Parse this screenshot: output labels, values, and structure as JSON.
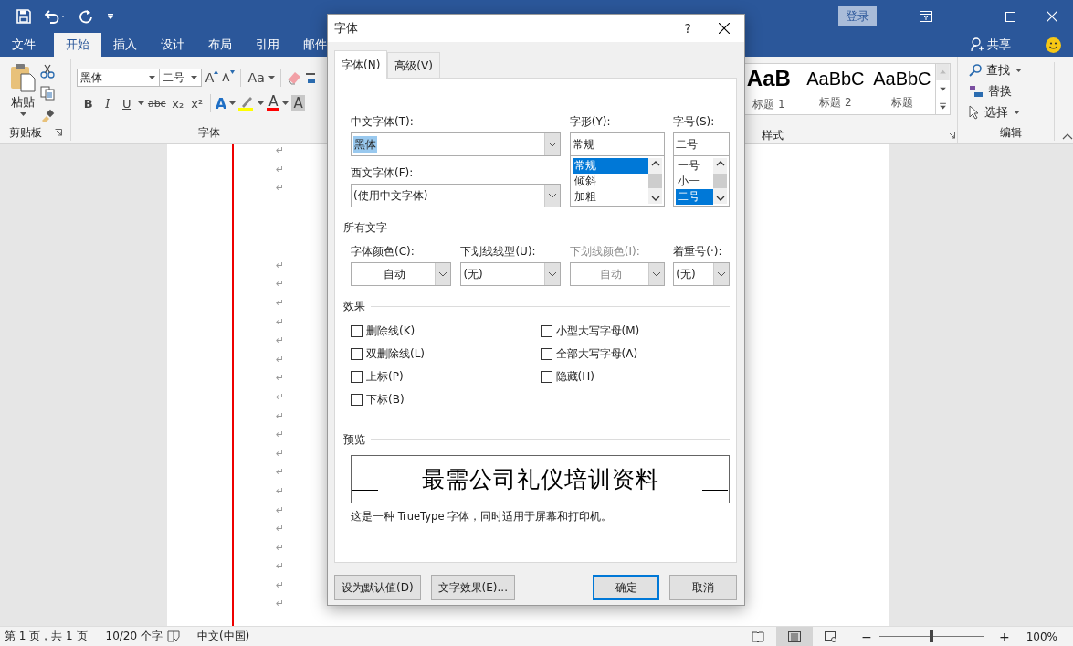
{
  "title_bar": {
    "sign_in": "登录"
  },
  "ribbon_tabs": [
    {
      "label": "文件",
      "selected": false
    },
    {
      "label": "开始",
      "selected": true
    },
    {
      "label": "插入",
      "selected": false
    },
    {
      "label": "设计",
      "selected": false
    },
    {
      "label": "布局",
      "selected": false
    },
    {
      "label": "引用",
      "selected": false
    },
    {
      "label": "邮件",
      "selected": false
    }
  ],
  "share": "共享",
  "ribbon": {
    "clipboard": {
      "paste": "粘贴",
      "label": "剪贴板"
    },
    "font": {
      "font_name": "黑体",
      "font_size": "二号",
      "grow": "A",
      "shrink": "A",
      "change_case": "Aa",
      "label": "字体",
      "format_buttons": [
        {
          "kind": "bold",
          "label": "B"
        },
        {
          "kind": "italic",
          "label": "I"
        },
        {
          "kind": "underline",
          "label": "U"
        },
        {
          "kind": "strike",
          "label": "abc"
        },
        {
          "kind": "subscript",
          "label": "x₂"
        },
        {
          "kind": "superscript",
          "label": "x²"
        }
      ],
      "color_buttons": [
        {
          "kind": "effect",
          "label": "A"
        },
        {
          "kind": "highlight",
          "color": "#ffff00"
        },
        {
          "kind": "font-color",
          "label": "A",
          "color": "#ff0000"
        },
        {
          "kind": "shading",
          "label": "A"
        }
      ]
    },
    "styles": {
      "label": "样式",
      "items": [
        {
          "preview": "AaB",
          "label": "标题 1",
          "bold": true
        },
        {
          "preview": "AaBbC",
          "label": "标题 2",
          "bold": false
        },
        {
          "preview": "AaBbC",
          "label": "标题",
          "bold": false
        }
      ]
    },
    "editing": {
      "find": "查找",
      "replace": "替换",
      "select": "选择",
      "label": "编辑"
    }
  },
  "document": {
    "marks_top": [
      "↵",
      "↵",
      "↵"
    ],
    "marks_bottom": [
      "↵",
      "↵",
      "↵",
      "↵",
      "↵",
      "↵",
      "↵",
      "↵",
      "↵",
      "↵",
      "↵",
      "↵",
      "↵",
      "↵",
      "↵",
      "↵",
      "↵",
      "↵",
      "↵"
    ]
  },
  "status_bar": {
    "page": "第 1 页，共 1 页",
    "words": "10/20 个字",
    "language": "中文(中国)",
    "views": [
      {
        "kind": "read",
        "selected": false
      },
      {
        "kind": "print",
        "selected": true
      },
      {
        "kind": "web",
        "selected": false
      }
    ],
    "zoom_out": "−",
    "zoom_in": "+",
    "zoom": {
      "level": 0.5
    },
    "zoom_text": "100%"
  },
  "dialog": {
    "title": "字体",
    "help": "?",
    "tabs": [
      {
        "label": "字体(N)",
        "selected": true
      },
      {
        "label": "高级(V)",
        "selected": false
      }
    ],
    "chinese_font": {
      "label": "中文字体(T):",
      "value": "黑体",
      "value_selected": true
    },
    "western_font": {
      "label": "西文字体(F):",
      "value": "(使用中文字体)",
      "value_selected": false
    },
    "font_style": {
      "label": "字形(Y):",
      "value": "常规",
      "options": [
        {
          "label": "常规",
          "selected": true
        },
        {
          "label": "倾斜",
          "selected": false
        },
        {
          "label": "加粗",
          "selected": false
        }
      ]
    },
    "size": {
      "label": "字号(S):",
      "value": "二号",
      "options": [
        {
          "label": "一号",
          "selected": false
        },
        {
          "label": "小一",
          "selected": false
        },
        {
          "label": "二号",
          "selected": true
        }
      ]
    },
    "all_text": {
      "heading": "所有文字",
      "fields": [
        {
          "label": "字体颜色(C):",
          "value": "自动",
          "kind": "color",
          "disabled": false
        },
        {
          "label": "下划线线型(U):",
          "value": "(无)",
          "kind": "list",
          "disabled": false
        },
        {
          "label": "下划线颜色(I):",
          "value": "自动",
          "kind": "color",
          "disabled": true
        },
        {
          "label": "着重号(·):",
          "value": "(无)",
          "kind": "list",
          "disabled": false
        }
      ]
    },
    "effects": {
      "heading": "效果",
      "left": [
        {
          "label": "删除线(K)",
          "checked": false
        },
        {
          "label": "双删除线(L)",
          "checked": false
        },
        {
          "label": "上标(P)",
          "checked": false
        },
        {
          "label": "下标(B)",
          "checked": false
        }
      ],
      "right": [
        {
          "label": "小型大写字母(M)",
          "checked": false
        },
        {
          "label": "全部大写字母(A)",
          "checked": false
        },
        {
          "label": "隐藏(H)",
          "checked": false
        }
      ]
    },
    "preview": {
      "heading": "预览",
      "sample": "最需公司礼仪培训资料",
      "note": "这是一种 TrueType 字体，同时适用于屏幕和打印机。"
    },
    "buttons": [
      {
        "label": "设为默认值(D)",
        "default": false
      },
      {
        "label": "文字效果(E)...",
        "default": false
      },
      {
        "label": "确定",
        "default": true
      },
      {
        "label": "取消",
        "default": false
      }
    ]
  }
}
